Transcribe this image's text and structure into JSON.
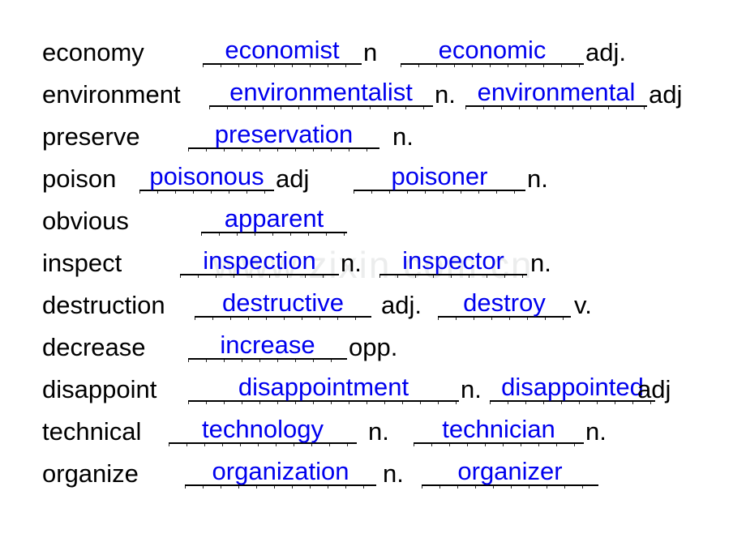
{
  "watermark": "www.zixin.com.cn",
  "colors": {
    "prompt": "#000000",
    "answer": "#0000ee",
    "rule": "#000000",
    "watermark": "#eceded",
    "background": "#ffffff"
  },
  "rows": [
    {
      "prompt": "economy",
      "answer1": "economist",
      "pos1": "n",
      "answer2": "economic",
      "pos2": "adj."
    },
    {
      "prompt": "environment",
      "answer1": "environmentalist",
      "pos1": "n.",
      "answer2": "environmental",
      "pos2": "adj"
    },
    {
      "prompt": "preserve",
      "answer1": "preservation",
      "pos1": "n.",
      "answer2": "",
      "pos2": ""
    },
    {
      "prompt": "poison",
      "answer1": "poisonous",
      "pos1": "adj",
      "answer2": "poisoner",
      "pos2": "n."
    },
    {
      "prompt": "obvious",
      "answer1": "apparent",
      "pos1": "",
      "answer2": "",
      "pos2": ""
    },
    {
      "prompt": "inspect",
      "answer1": "inspection",
      "pos1": "n.",
      "answer2": "inspector",
      "pos2": "n."
    },
    {
      "prompt": "destruction",
      "answer1": "destructive",
      "pos1": "adj.",
      "answer2": "destroy",
      "pos2": "v."
    },
    {
      "prompt": "decrease",
      "answer1": "increase",
      "pos1": "opp.",
      "answer2": "",
      "pos2": ""
    },
    {
      "prompt": "disappoint",
      "answer1": "disappointment",
      "pos1": "n.",
      "answer2": "disappointed",
      "pos2": "adj"
    },
    {
      "prompt": "technical",
      "answer1": "technology",
      "pos1": "n.",
      "answer2": "technician",
      "pos2": "n."
    },
    {
      "prompt": "organize",
      "answer1": "organization",
      "pos1": "n.",
      "answer2": "organizer",
      "pos2": ""
    }
  ]
}
